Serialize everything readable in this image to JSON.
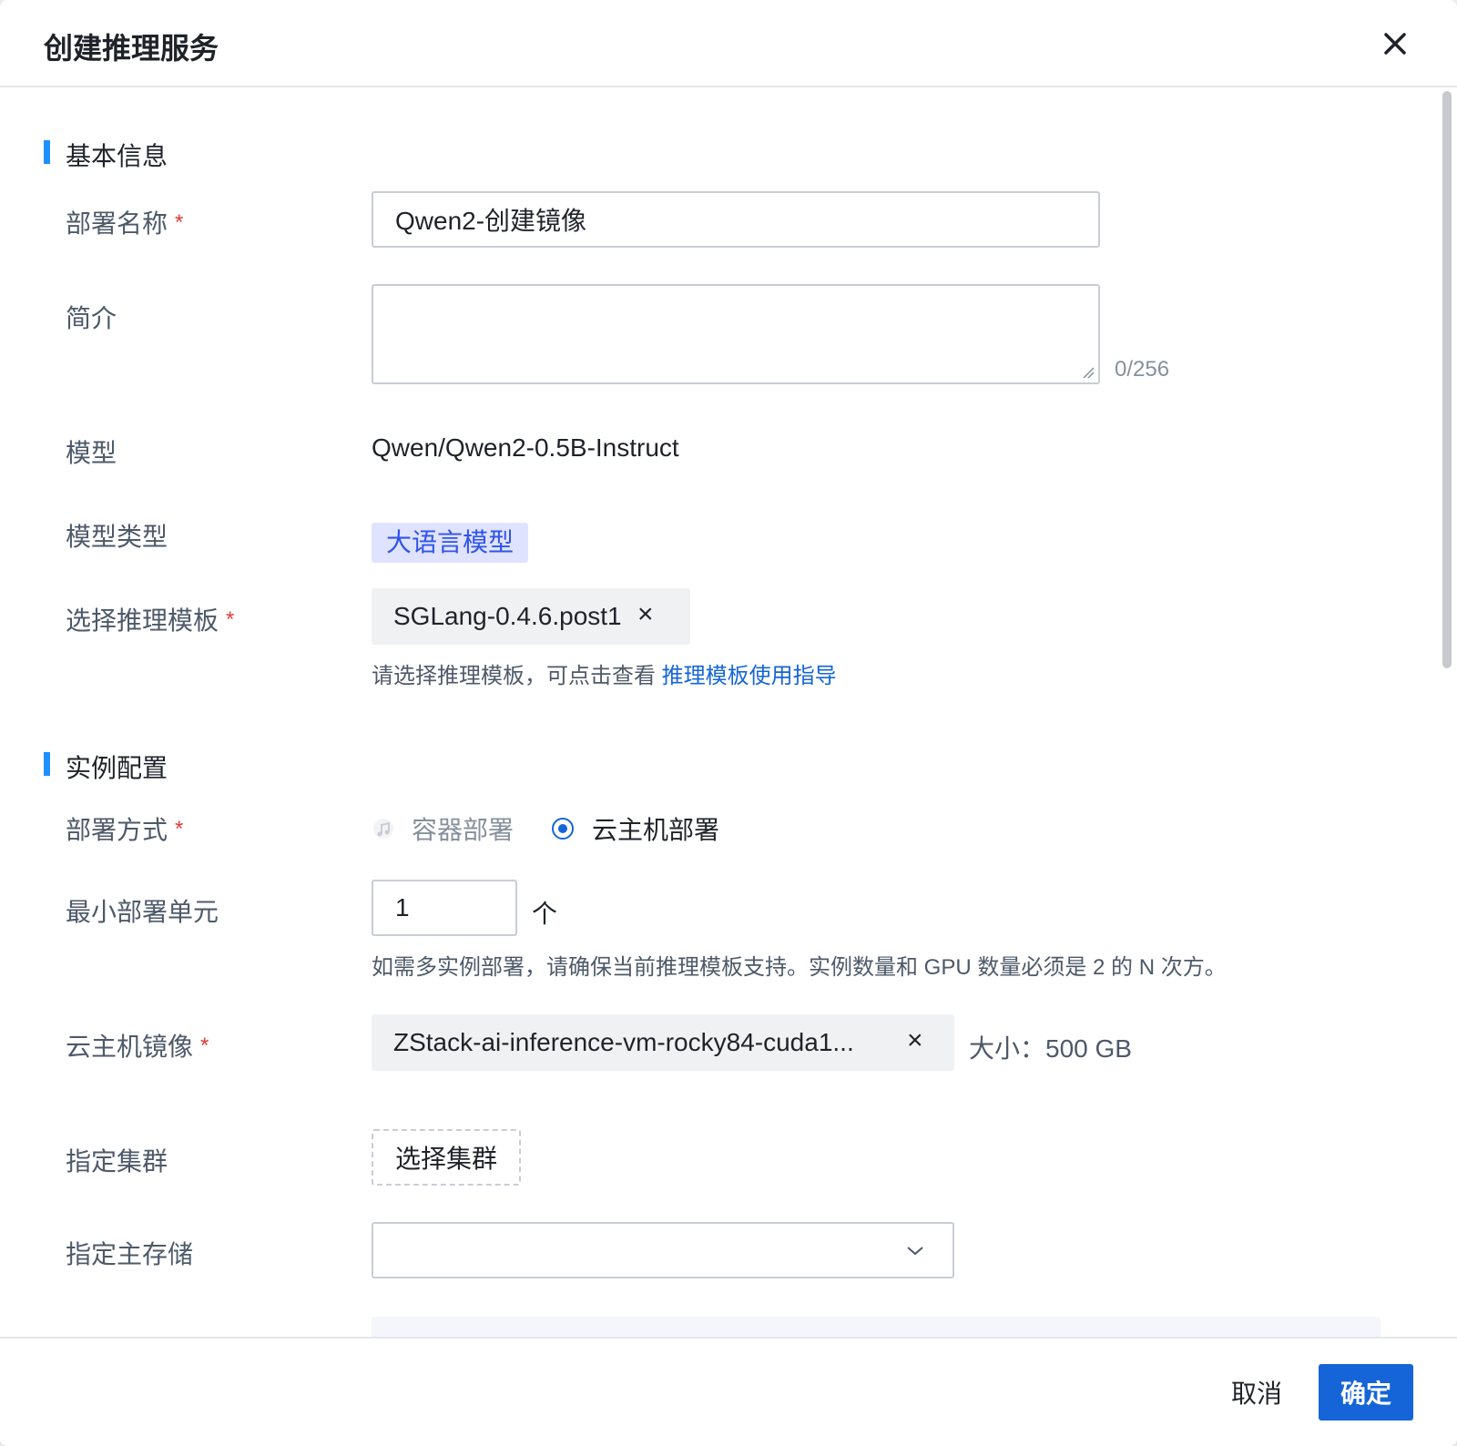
{
  "dialog": {
    "title": "创建推理服务",
    "close_icon": "close-icon"
  },
  "sections": {
    "basic": "基本信息",
    "instance": "实例配置"
  },
  "form": {
    "deploy_name": {
      "label": "部署名称",
      "required_mark": "*",
      "value": "Qwen2-创建镜像"
    },
    "description": {
      "label": "简介",
      "value": "",
      "counter": "0/256"
    },
    "model": {
      "label": "模型",
      "value": "Qwen/Qwen2-0.5B-Instruct"
    },
    "model_type": {
      "label": "模型类型",
      "tag": "大语言模型"
    },
    "template": {
      "label": "选择推理模板",
      "required_mark": "*",
      "value": "SGLang-0.4.6.post1",
      "remove": "×",
      "help_text": "请选择推理模板，可点击查看 ",
      "help_link": "推理模板使用指导"
    },
    "deploy_mode": {
      "label": "部署方式",
      "required_mark": "*",
      "options": [
        "容器部署",
        "云主机部署"
      ],
      "selected": "云主机部署"
    },
    "min_unit": {
      "label": "最小部署单元",
      "value": "1",
      "unit": "个",
      "help_text": "如需多实例部署，请确保当前推理模板支持。实例数量和 GPU 数量必须是 2 的 N 次方。"
    },
    "vm_image": {
      "label": "云主机镜像",
      "required_mark": "*",
      "value": "ZStack-ai-inference-vm-rocky84-cuda1...",
      "remove": "×",
      "size": "大小：500 GB"
    },
    "cluster": {
      "label": "指定集群",
      "button": "选择集群"
    },
    "primary_storage": {
      "label": "指定主存储",
      "value": ""
    }
  },
  "footer": {
    "cancel": "取消",
    "confirm": "确定"
  },
  "colors": {
    "accent": "#1565d8",
    "required": "#e53935",
    "section_bar": "#1e90ff",
    "tag_bg": "#e0e3ff",
    "tag_text": "#2f54eb"
  }
}
